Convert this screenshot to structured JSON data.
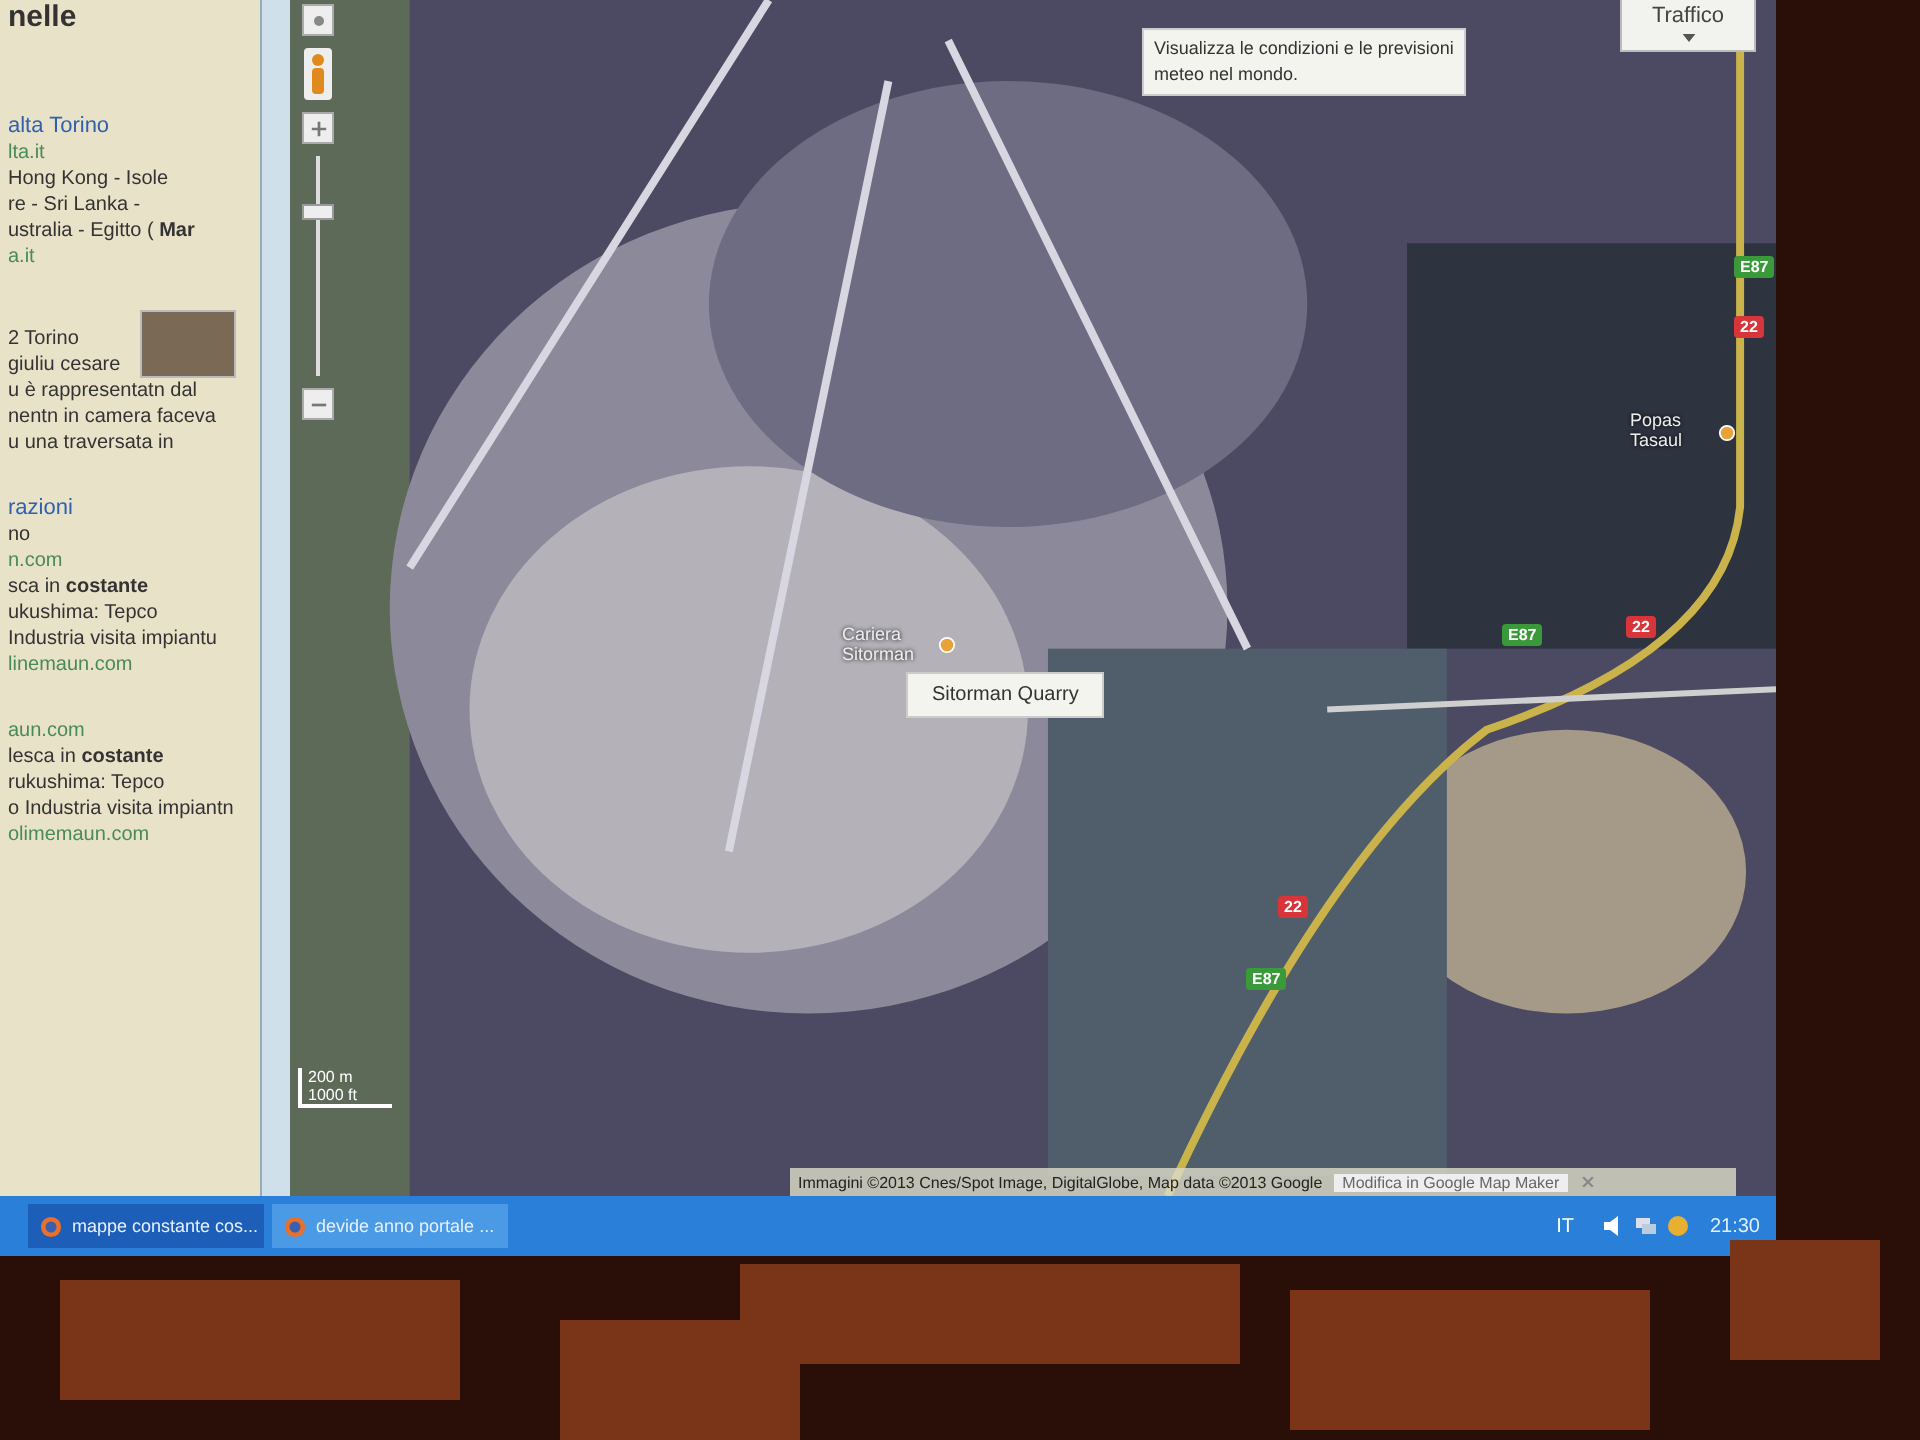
{
  "sidebar": {
    "heading": "nelle",
    "results": [
      {
        "lines": [
          {
            "kind": "title",
            "text": "alta Torino"
          },
          {
            "kind": "url",
            "text": "lta.it"
          },
          {
            "kind": "text",
            "text": "Hong Kong - Isole"
          },
          {
            "kind": "text",
            "text": "re - Sri Lanka -"
          },
          {
            "kind": "text",
            "text": "ustralia - Egitto ( **Mar**"
          },
          {
            "kind": "url",
            "text": "a.it"
          }
        ]
      },
      {
        "lines": [
          {
            "kind": "text",
            "text": "2 Torino"
          },
          {
            "kind": "text",
            "text": "giuliu cesare"
          },
          {
            "kind": "text",
            "text": "u è rappresentatn dal"
          },
          {
            "kind": "text",
            "text": "nentn in camera faceva"
          },
          {
            "kind": "text",
            "text": "u una traversata in"
          }
        ],
        "media": {
          "kind": "photo"
        }
      },
      {
        "lines": [
          {
            "kind": "title",
            "text": "razioni"
          },
          {
            "kind": "text",
            "text": "no"
          },
          {
            "kind": "url",
            "text": "n.com"
          },
          {
            "kind": "text",
            "text": "sca in **costante**"
          },
          {
            "kind": "text",
            "text": "ukushima: Tepco"
          },
          {
            "kind": "text",
            "text": "Industria visita impiantu"
          },
          {
            "kind": "url",
            "text": "linemaun.com"
          }
        ]
      },
      {
        "lines": [
          {
            "kind": "url",
            "text": "aun.com"
          },
          {
            "kind": "text",
            "text": "lesca in **costante**"
          },
          {
            "kind": "text",
            "text": "rukushima: Tepco"
          },
          {
            "kind": "text",
            "text": "o Industria visita impiantn"
          },
          {
            "kind": "url",
            "text": "olimemaun.com"
          }
        ]
      }
    ]
  },
  "map": {
    "zoom_slider": {
      "level": 0.75
    },
    "traffic_button": "Traffico",
    "weather_tooltip": "Visualizza le condizioni e le previsioni meteo nel mondo.",
    "road_shields": [
      {
        "label": "E87",
        "color": "#3a9a3a"
      },
      {
        "label": "22",
        "color": "#d8353a"
      },
      {
        "label": "E87",
        "color": "#3a9a3a"
      },
      {
        "label": "22",
        "color": "#d8353a"
      },
      {
        "label": "22",
        "color": "#d8353a"
      },
      {
        "label": "E87",
        "color": "#3a9a3a"
      }
    ],
    "places": [
      {
        "label": "Popas Tasaul"
      },
      {
        "label": "Cariera Sitorman"
      }
    ],
    "hover_tooltip": "Sitorman Quarry",
    "scale": [
      "200 m",
      "1000 ft"
    ],
    "attribution": "Immagini ©2013 Cnes/Spot Image, DigitalGlobe, Map data ©2013 Google",
    "map_maker_link": "Modifica in Google Map Maker"
  },
  "taskbar": {
    "tasks": [
      {
        "label": "mappe constante cos...",
        "selected": true
      },
      {
        "label": "devide anno portale ...",
        "selected": false
      }
    ],
    "language": "IT",
    "clock": "21:30"
  }
}
